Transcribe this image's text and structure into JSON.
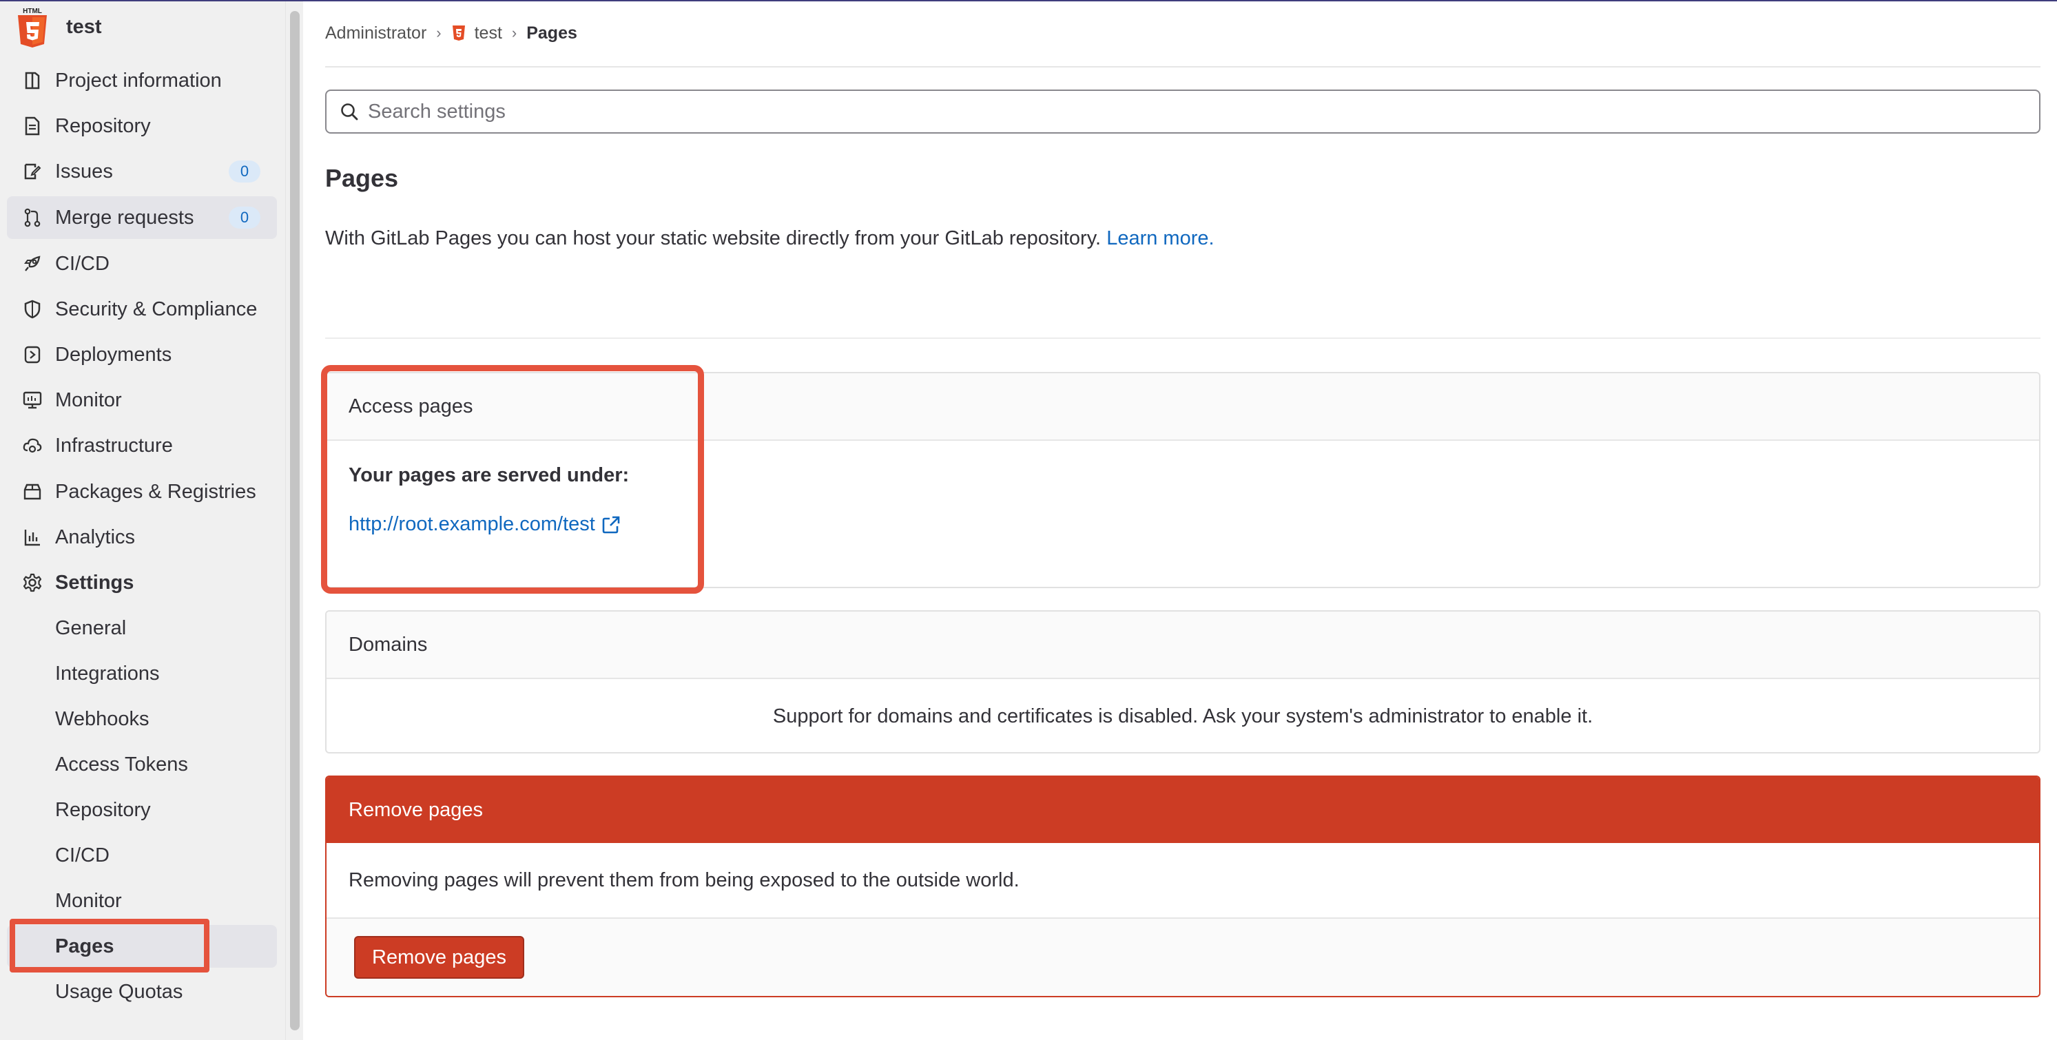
{
  "project": {
    "name": "test",
    "avatar_icon": "html5-logo-icon",
    "avatar_caption": "HTML"
  },
  "sidebar": {
    "items": [
      {
        "label": "Project information",
        "icon": "info-icon"
      },
      {
        "label": "Repository",
        "icon": "document-icon"
      },
      {
        "label": "Issues",
        "icon": "issues-icon",
        "badge": "0"
      },
      {
        "label": "Merge requests",
        "icon": "merge-request-icon",
        "badge": "0"
      },
      {
        "label": "CI/CD",
        "icon": "rocket-icon"
      },
      {
        "label": "Security & Compliance",
        "icon": "shield-icon"
      },
      {
        "label": "Deployments",
        "icon": "deployments-icon"
      },
      {
        "label": "Monitor",
        "icon": "monitor-icon"
      },
      {
        "label": "Infrastructure",
        "icon": "cloud-gear-icon"
      },
      {
        "label": "Packages & Registries",
        "icon": "package-icon"
      },
      {
        "label": "Analytics",
        "icon": "chart-icon"
      },
      {
        "label": "Settings",
        "icon": "gear-icon"
      }
    ],
    "settings_sub": [
      {
        "label": "General"
      },
      {
        "label": "Integrations"
      },
      {
        "label": "Webhooks"
      },
      {
        "label": "Access Tokens"
      },
      {
        "label": "Repository"
      },
      {
        "label": "CI/CD"
      },
      {
        "label": "Monitor"
      },
      {
        "label": "Pages"
      },
      {
        "label": "Usage Quotas"
      }
    ]
  },
  "breadcrumb": {
    "root": "Administrator",
    "project": "test",
    "current": "Pages"
  },
  "search": {
    "placeholder": "Search settings"
  },
  "page": {
    "title": "Pages",
    "intro": "With GitLab Pages you can host your static website directly from your GitLab repository.",
    "learn_more": "Learn more."
  },
  "access": {
    "title": "Access pages",
    "served_label": "Your pages are served under:",
    "url": "http://root.example.com/test"
  },
  "domains": {
    "title": "Domains",
    "message": "Support for domains and certificates is disabled. Ask your system's administrator to enable it."
  },
  "remove": {
    "title": "Remove pages",
    "description": "Removing pages will prevent them from being exposed to the outside world.",
    "button": "Remove pages"
  },
  "colors": {
    "danger": "#cc3c24",
    "link": "#1068bf",
    "highlight": "#e5533d",
    "badge_bg": "#dbe9f8"
  }
}
